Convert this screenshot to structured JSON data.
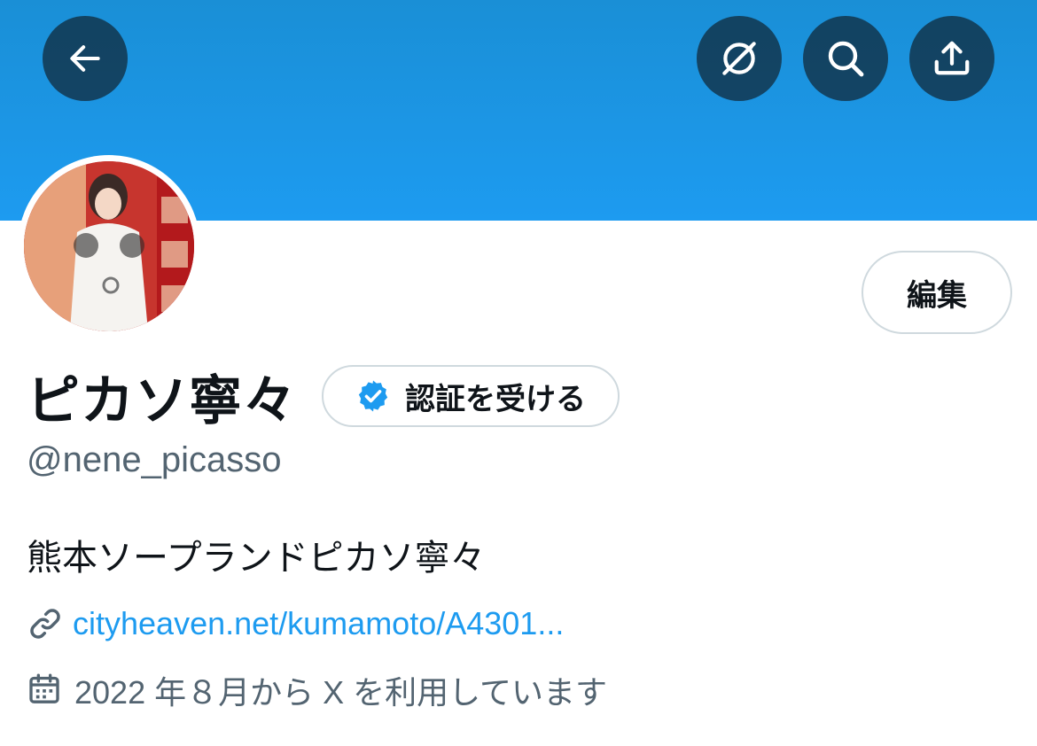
{
  "header": {
    "back_icon": "arrow-left-icon",
    "explore_icon": "compass-icon",
    "search_icon": "search-icon",
    "share_icon": "share-upload-icon",
    "banner_color": "#1d9bf0"
  },
  "profile": {
    "edit_label": "編集",
    "display_name": "ピカソ寧々",
    "verify_label": "認証を受ける",
    "verify_badge_icon": "verified-badge-icon",
    "handle": "@nene_picasso",
    "bio": "熊本ソープランドピカソ寧々",
    "link_icon": "link-icon",
    "link_text": "cityheaven.net/kumamoto/A4301...",
    "calendar_icon": "calendar-icon",
    "joined_text": "2022 年８月から X を利用しています"
  },
  "colors": {
    "accent": "#1d9bf0",
    "text_primary": "#0f1419",
    "text_secondary": "#536471",
    "border": "#cfd9de"
  }
}
